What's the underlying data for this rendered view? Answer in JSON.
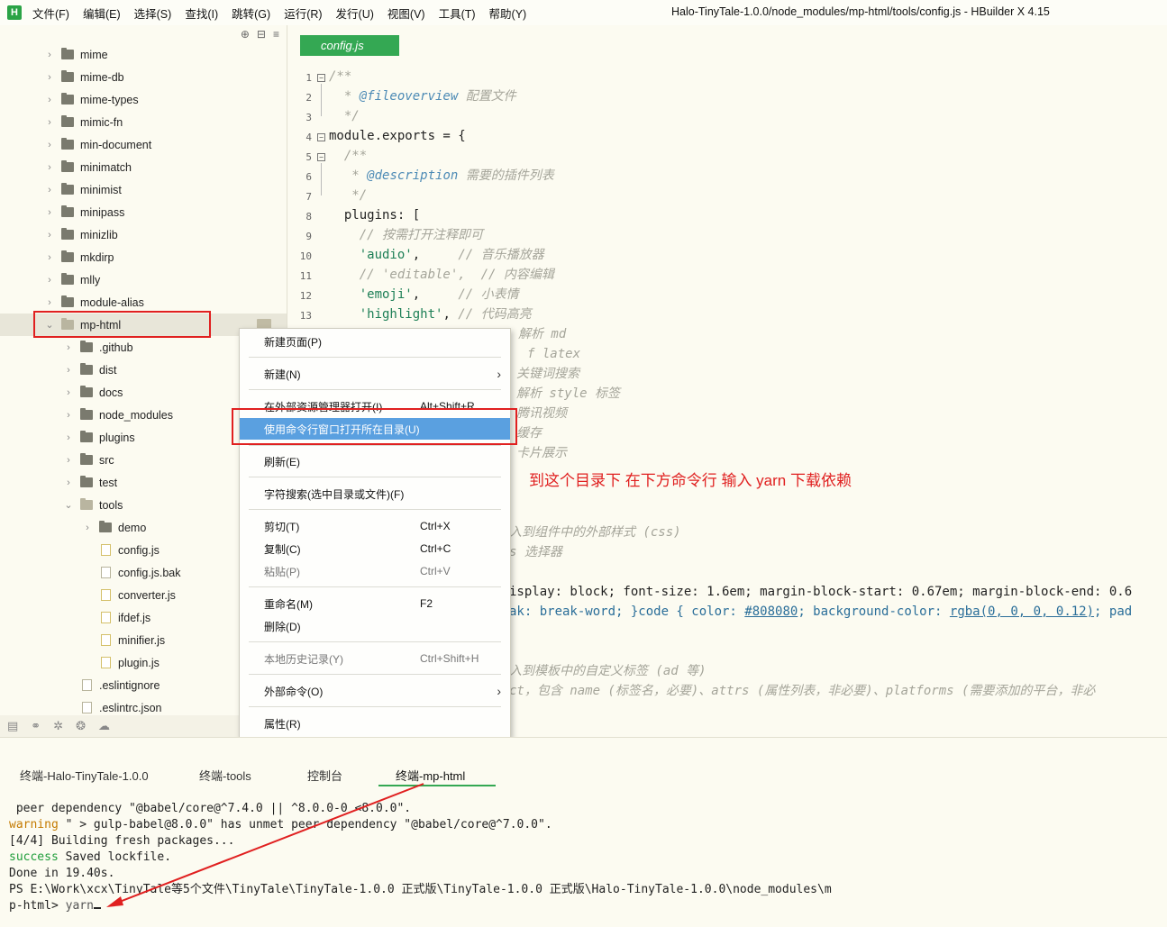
{
  "menubar": {
    "items": [
      "文件(F)",
      "编辑(E)",
      "选择(S)",
      "查找(I)",
      "跳转(G)",
      "运行(R)",
      "发行(U)",
      "视图(V)",
      "工具(T)",
      "帮助(Y)"
    ],
    "window_title": "Halo-TinyTale-1.0.0/node_modules/mp-html/tools/config.js - HBuilder X 4.15",
    "logo": "H"
  },
  "sidebar": {
    "tree": [
      {
        "label": "mime",
        "type": "folder",
        "level": 0
      },
      {
        "label": "mime-db",
        "type": "folder",
        "level": 0
      },
      {
        "label": "mime-types",
        "type": "folder",
        "level": 0
      },
      {
        "label": "mimic-fn",
        "type": "folder",
        "level": 0
      },
      {
        "label": "min-document",
        "type": "folder",
        "level": 0
      },
      {
        "label": "minimatch",
        "type": "folder",
        "level": 0
      },
      {
        "label": "minimist",
        "type": "folder",
        "level": 0
      },
      {
        "label": "minipass",
        "type": "folder",
        "level": 0
      },
      {
        "label": "minizlib",
        "type": "folder",
        "level": 0
      },
      {
        "label": "mkdirp",
        "type": "folder",
        "level": 0
      },
      {
        "label": "mlly",
        "type": "folder",
        "level": 0
      },
      {
        "label": "module-alias",
        "type": "folder",
        "level": 0
      },
      {
        "label": "mp-html",
        "type": "folder-open",
        "level": 0
      },
      {
        "label": ".github",
        "type": "folder",
        "level": 1
      },
      {
        "label": "dist",
        "type": "folder",
        "level": 1
      },
      {
        "label": "docs",
        "type": "folder",
        "level": 1
      },
      {
        "label": "node_modules",
        "type": "folder",
        "level": 1
      },
      {
        "label": "plugins",
        "type": "folder",
        "level": 1
      },
      {
        "label": "src",
        "type": "folder",
        "level": 1
      },
      {
        "label": "test",
        "type": "folder",
        "level": 1
      },
      {
        "label": "tools",
        "type": "folder-open",
        "level": 1
      },
      {
        "label": "demo",
        "type": "folder",
        "level": 2
      },
      {
        "label": "config.js",
        "type": "file-js",
        "level": 2
      },
      {
        "label": "config.js.bak",
        "type": "file",
        "level": 2
      },
      {
        "label": "converter.js",
        "type": "file-js",
        "level": 2
      },
      {
        "label": "ifdef.js",
        "type": "file-js",
        "level": 2
      },
      {
        "label": "minifier.js",
        "type": "file-js",
        "level": 2
      },
      {
        "label": "plugin.js",
        "type": "file-js",
        "level": 2
      },
      {
        "label": ".eslintignore",
        "type": "file",
        "level": 1
      },
      {
        "label": ".eslintrc.json",
        "type": "file",
        "level": 1
      }
    ]
  },
  "editor": {
    "tab_label": "config.js",
    "line_numbers": [
      "1",
      "2",
      "3",
      "4",
      "5",
      "6",
      "7",
      "8",
      "9",
      "10",
      "11",
      "12",
      "13"
    ],
    "annotation": "到这个目录下  在下方命令行 输入 yarn 下载依赖"
  },
  "context_menu": {
    "items": [
      {
        "label": "新建页面(P)",
        "shortcut": ""
      },
      {
        "label": "新建(N)",
        "shortcut": ""
      },
      {
        "label": "在外部资源管理器打开(I)",
        "shortcut": "Alt+Shift+R"
      },
      {
        "label": "使用命令行窗口打开所在目录(U)",
        "shortcut": ""
      },
      {
        "label": "刷新(E)",
        "shortcut": ""
      },
      {
        "label": "字符搜索(选中目录或文件)(F)",
        "shortcut": ""
      },
      {
        "label": "剪切(T)",
        "shortcut": "Ctrl+X"
      },
      {
        "label": "复制(C)",
        "shortcut": "Ctrl+C"
      },
      {
        "label": "粘贴(P)",
        "shortcut": "Ctrl+V"
      },
      {
        "label": "重命名(M)",
        "shortcut": "F2"
      },
      {
        "label": "删除(D)",
        "shortcut": ""
      },
      {
        "label": "本地历史记录(Y)",
        "shortcut": "Ctrl+Shift+H"
      },
      {
        "label": "外部命令(O)",
        "shortcut": ""
      },
      {
        "label": "属性(R)",
        "shortcut": ""
      }
    ]
  },
  "panel": {
    "tabs": [
      "终端-Halo-TinyTale-1.0.0",
      "终端-tools",
      "控制台",
      "终端-mp-html"
    ],
    "terminal_lines": [
      " peer dependency \"@babel/core@^7.4.0 || ^8.0.0-0 <8.0.0\".",
      "\" > gulp-babel@8.0.0\" has unmet peer dependency \"@babel/core@^7.0.0\".",
      "[4/4] Building fresh packages...",
      " Saved lockfile.",
      "Done in 19.40s.",
      "PS E:\\Work\\xcx\\TinyTale等5个文件\\TinyTale\\TinyTale-1.0.0 正式版\\TinyTale-1.0.0 正式版\\Halo-TinyTale-1.0.0\\node_modules\\m",
      "p-html> "
    ],
    "warning_word": "warning",
    "success_word": "success",
    "command": "yarn"
  },
  "colors": {
    "accent": "#34a853",
    "annotation_red": "#e02020",
    "menu_highlight": "#5aa0e0"
  }
}
